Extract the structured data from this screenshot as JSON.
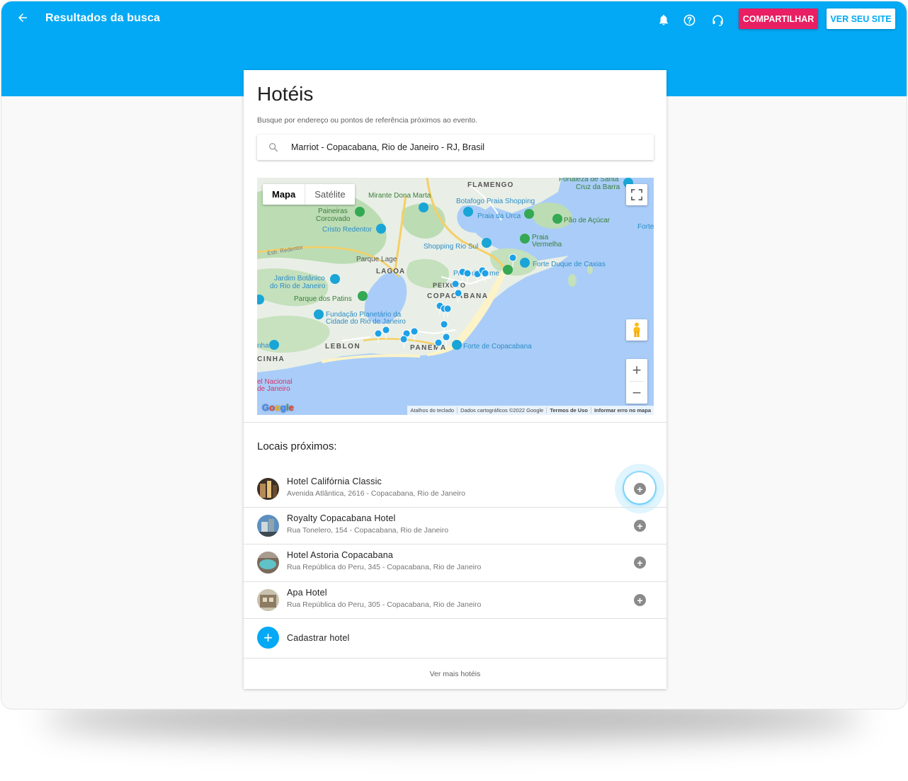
{
  "header": {
    "back_icon": "arrow-left-icon",
    "title": "Resultados da busca",
    "icons": [
      "bell-icon",
      "help-icon",
      "headset-icon"
    ],
    "share_label": "COMPARTILHAR",
    "site_label": "VER SEU SITE",
    "colors": {
      "bar": "#03a9f4",
      "share": "#e91e63"
    }
  },
  "card": {
    "title": "Hotéis",
    "subtitle": "Busque por endereço ou pontos de referência próximos ao evento.",
    "search": {
      "value": "Marriot - Copacabana, Rio de Janeiro - RJ, Brasil",
      "icon": "search-icon"
    }
  },
  "map": {
    "type_map": "Mapa",
    "type_satellite": "Satélite",
    "labels": {
      "flamengo": "FLAMENGO",
      "fortaleza": "Fortaleza de Santa",
      "cruz": "Cruz da Barra",
      "mirante": "Mirante Dona Marta",
      "botafogo": "Botafogo Praia Shopping",
      "paineiras1": "Paineiras",
      "paineiras2": "Corcovado",
      "cristo": "Cristo Redentor",
      "urca": "Praia da Urca",
      "pao": "Pão de Açúcar",
      "forte_right": "Forte",
      "vermelha1": "Praia",
      "vermelha2": "Vermelha",
      "estr": "Estr. Redentor",
      "rio_sul": "Shopping Rio Sul",
      "parque_lage": "Parque Lage",
      "lagoa": "LAGOA",
      "leme": "Praia do Leme",
      "caxias": "Forte Duque de Caxias",
      "jardim1": "Jardim Botânico",
      "jardim2": "do Rio de Janeiro",
      "peixoto": "PEIXOTO",
      "copacabana": "COPACABANA",
      "patins": "Parque dos Patins",
      "planetario1": "Fundação Planetário da",
      "planetario2": "Cidade do Rio de Janeiro",
      "leblon": "LEBLON",
      "ipanema": "PANEMA",
      "forte_copa": "Forte de Copacabana",
      "inha": "nha",
      "cinha": "CINHA",
      "nacional1": "el Nacional",
      "nacional2": "de Janeiro"
    },
    "google": "Google",
    "attribution": [
      "Atalhos do teclado",
      "Dados cartográficos ©2022 Google",
      "Termos de Uso",
      "Informar erro no mapa"
    ]
  },
  "nearby": {
    "title": "Locais próximos:",
    "items": [
      {
        "name": "Hotel Califórnia Classic",
        "address": "Avenida Atlântica, 2616 - Copacabana, Rio de Janeiro"
      },
      {
        "name": "Royalty Copacabana Hotel",
        "address": "Rua Tonelero, 154 - Copacabana, Rio de Janeiro"
      },
      {
        "name": "Hotel Astoria Copacabana",
        "address": "Rua República do Peru, 345 - Copacabana, Rio de Janeiro"
      },
      {
        "name": "Apa Hotel",
        "address": "Rua República do Peru, 305 - Copacabana, Rio de Janeiro"
      }
    ],
    "register_label": "Cadastrar hotel",
    "more_label": "Ver mais hotéis"
  }
}
